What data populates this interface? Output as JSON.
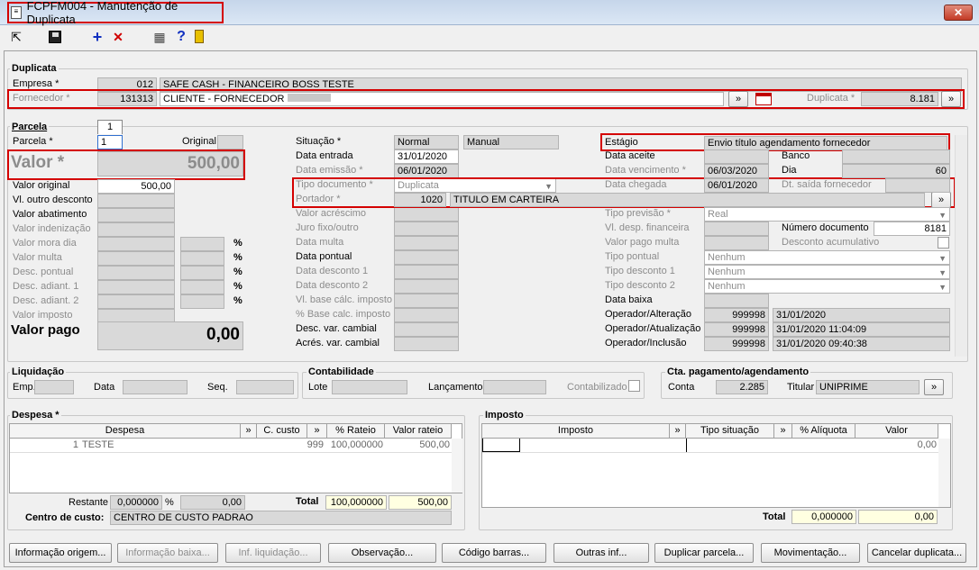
{
  "window": {
    "title": "FCPFM004 - Manutenção de Duplicata",
    "close": "✕"
  },
  "toolbar": {
    "exit": "⇱",
    "save": "💾",
    "add": "+",
    "delete": "✕",
    "calc": "▦",
    "help": "?",
    "door": "🚪"
  },
  "duplicata": {
    "title": "Duplicata",
    "empresa_label": "Empresa *",
    "empresa_code": "012",
    "empresa_name": "SAFE CASH - FINANCEIRO BOSS TESTE",
    "fornecedor_label": "Fornecedor *",
    "fornecedor_code": "131313",
    "fornecedor_name": "CLIENTE - FORNECEDOR",
    "duplicata_label": "Duplicata *",
    "duplicata_value": "8.181",
    "btn": "»"
  },
  "parcela": {
    "title": "Parcela",
    "tab": "1",
    "parcela_label": "Parcela *",
    "parcela_value": "1",
    "original_label": "Original",
    "valor_label": "Valor *",
    "valor_value": "500,00",
    "left_rows": [
      {
        "label": "Valor original",
        "value": "500,00",
        "dim": false
      },
      {
        "label": "Vl. outro desconto",
        "value": "",
        "dim": false
      },
      {
        "label": "Valor abatimento",
        "value": "",
        "dim": false
      },
      {
        "label": "Valor indenização",
        "value": "",
        "dim": true
      },
      {
        "label": "Valor mora dia",
        "value": "",
        "dim": true,
        "pct": "%"
      },
      {
        "label": "Valor multa",
        "value": "",
        "dim": true,
        "pct": "%"
      },
      {
        "label": "Desc. pontual",
        "value": "",
        "dim": true,
        "pct": "%"
      },
      {
        "label": "Desc. adiant. 1",
        "value": "",
        "dim": true,
        "pct": "%"
      },
      {
        "label": "Desc. adiant. 2",
        "value": "",
        "dim": true,
        "pct": "%"
      },
      {
        "label": "Valor imposto",
        "value": "",
        "dim": true
      }
    ],
    "valor_pago_label": "Valor pago",
    "valor_pago_value": "0,00",
    "situacao_label": "Situação *",
    "situacao_1": "Normal",
    "situacao_2": "Manual",
    "mid_rows": [
      {
        "label": "Data entrada",
        "value": "31/01/2020",
        "dim": false
      },
      {
        "label": "Data emissão *",
        "value": "06/01/2020",
        "dim": true
      },
      {
        "label": "Tipo documento *",
        "value": "Duplicata",
        "dim": true,
        "combo": true
      },
      {
        "label": "Portador *",
        "value": "",
        "dim": true
      },
      {
        "label": "Valor acréscimo",
        "value": "",
        "dim": true
      },
      {
        "label": "Juro fixo/outro",
        "value": "",
        "dim": true
      },
      {
        "label": "Data multa",
        "value": "",
        "dim": true
      },
      {
        "label": "Data pontual",
        "value": "",
        "dim": false
      },
      {
        "label": "Data desconto 1",
        "value": "",
        "dim": true
      },
      {
        "label": "Data desconto 2",
        "value": "",
        "dim": true
      },
      {
        "label": "Vl. base cálc. imposto",
        "value": "",
        "dim": true
      },
      {
        "label": "% Base calc. imposto",
        "value": "",
        "dim": true
      },
      {
        "label": "Desc. var. cambial",
        "value": "",
        "dim": false
      },
      {
        "label": "Acrés. var. cambial",
        "value": "",
        "dim": false
      }
    ],
    "portador_code": "1020",
    "portador_name": "TITULO EM CARTEIRA",
    "estagio_label": "Estágio",
    "estagio_value": "Envio título agendamento fornecedor",
    "data_aceite": "Data aceite",
    "banco": "Banco",
    "data_venc_label": "Data vencimento *",
    "data_venc_value": "06/03/2020",
    "dia_label": "Dia",
    "dia_value": "60",
    "data_chegada_label": "Data chegada",
    "data_chegada_value": "06/01/2020",
    "dt_saida_label": "Dt. saída fornecedor",
    "tipo_previsao_label": "Tipo previsão *",
    "tipo_previsao_value": "Real",
    "vl_desp_label": "Vl. desp. financeira",
    "num_doc_label": "Número documento",
    "num_doc_value": "8181",
    "valor_pago_multa": "Valor pago multa",
    "desconto_acum": "Desconto acumulativo",
    "tipo_pontual_label": "Tipo pontual",
    "tipo_desc1_label": "Tipo desconto 1",
    "tipo_desc2_label": "Tipo desconto 2",
    "nenhum": "Nenhum",
    "data_baixa": "Data baixa",
    "op_alt_label": "Operador/Alteração",
    "op_alt_code": "999998",
    "op_alt_date": "31/01/2020",
    "op_atu_label": "Operador/Atualização",
    "op_atu_code": "999998",
    "op_atu_date": "31/01/2020 11:04:09",
    "op_inc_label": "Operador/Inclusão",
    "op_inc_code": "999998",
    "op_inc_date": "31/01/2020 09:40:38"
  },
  "liquidacao": {
    "title": "Liquidação",
    "emp": "Emp.",
    "data": "Data",
    "seq": "Seq."
  },
  "contabilidade": {
    "title": "Contabilidade",
    "lote": "Lote",
    "lancamento": "Lançamento",
    "contabilizado": "Contabilizado"
  },
  "cta": {
    "title": "Cta. pagamento/agendamento",
    "conta_label": "Conta",
    "conta_value": "2.285",
    "titular_label": "Titular",
    "titular_value": "UNIPRIME"
  },
  "despesa": {
    "title": "Despesa *",
    "cols": [
      "Despesa",
      "C. custo",
      "% Rateio",
      "Valor rateio"
    ],
    "row": {
      "code": "1",
      "name": "TESTE",
      "ccusto": "999",
      "rateio": "100,000000",
      "valor": "500,00"
    },
    "restante_label": "Restante",
    "restante_pct": "0,000000",
    "pct": "%",
    "restante_val": "0,00",
    "total_label": "Total",
    "total_pct": "100,000000",
    "total_val": "500,00",
    "centro_label": "Centro de custo:",
    "centro_value": "CENTRO DE CUSTO PADRAO"
  },
  "imposto": {
    "title": "Imposto",
    "cols": [
      "Imposto",
      "Tipo situação",
      "% Alíquota",
      "Valor"
    ],
    "row_valor": "0,00",
    "total_label": "Total",
    "total_pct": "0,000000",
    "total_val": "0,00"
  },
  "buttons": [
    "Informação origem...",
    "Informação baixa...",
    "Inf. liquidação...",
    "Observação...",
    "Código barras...",
    "Outras inf...",
    "Duplicar parcela...",
    "Movimentação...",
    "Cancelar duplicata..."
  ]
}
